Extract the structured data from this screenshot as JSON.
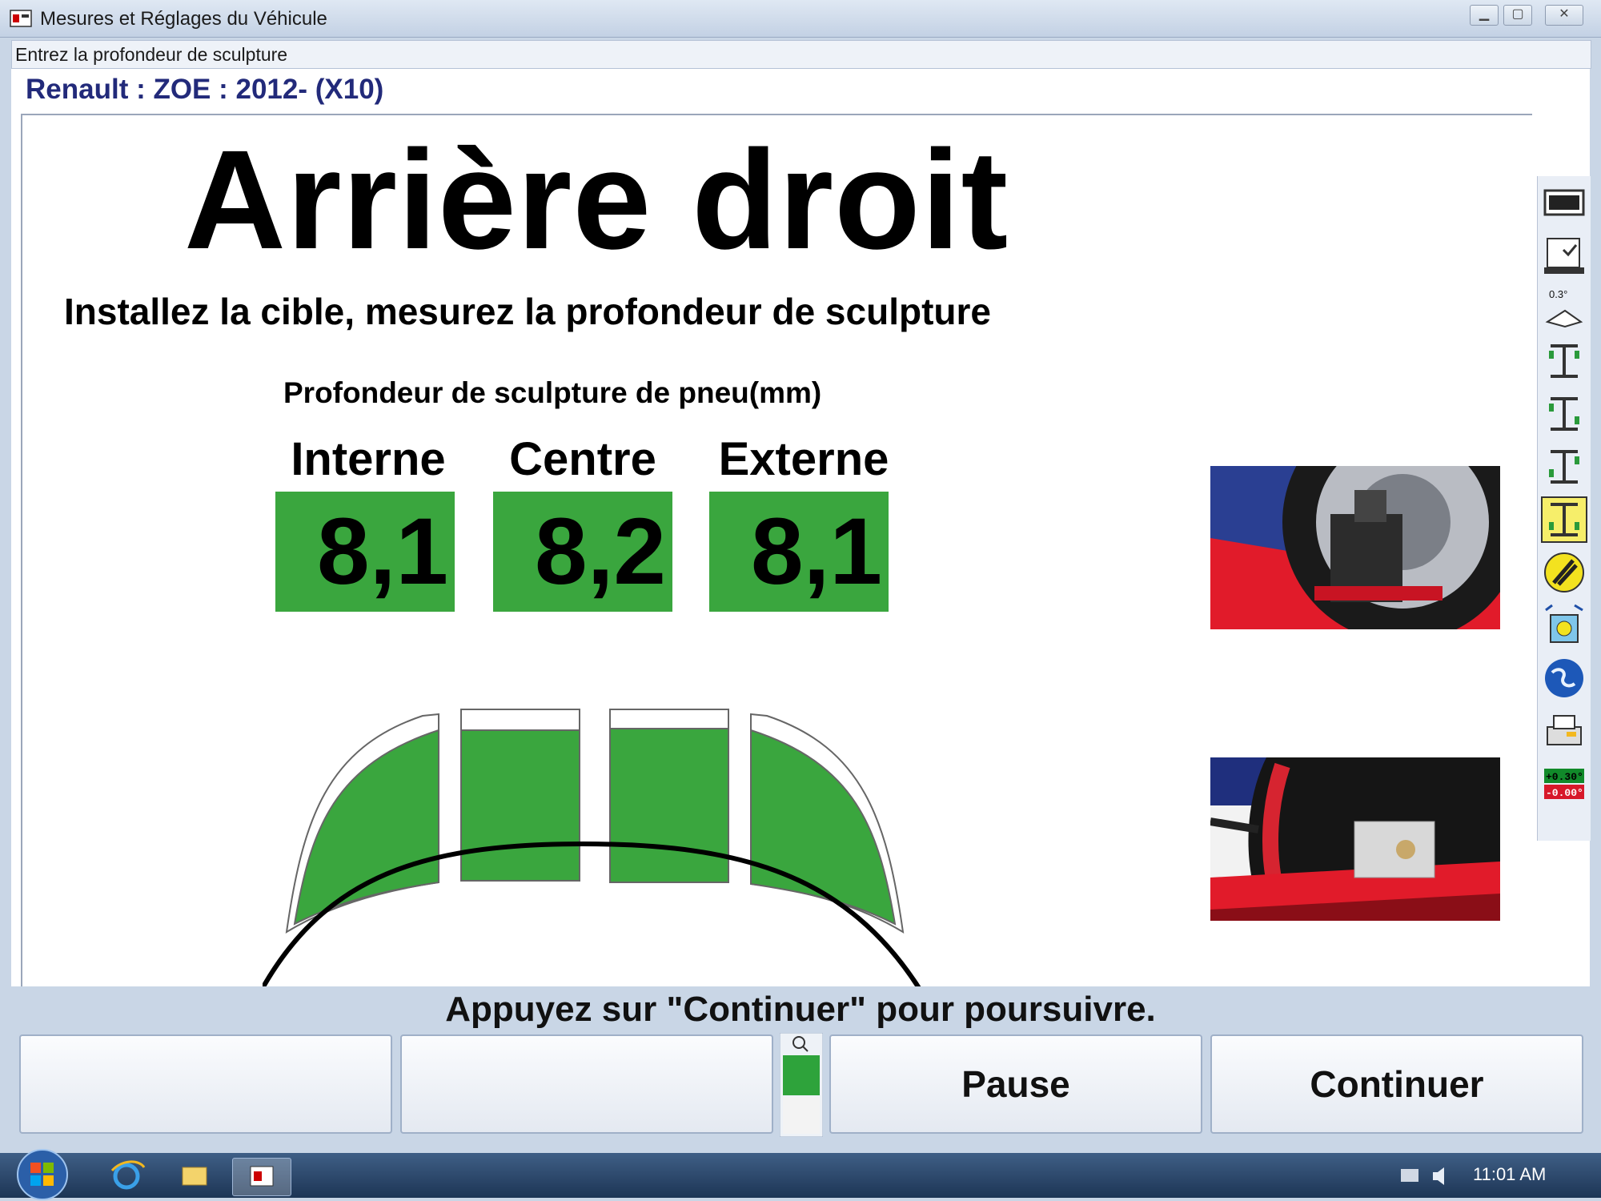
{
  "window": {
    "title": "Mesures et Réglages du Véhicule"
  },
  "prompt": "Entrez la profondeur de sculpture",
  "vehicle": "Renault : ZOE : 2012-   (X10)",
  "heading": "Arrière droit",
  "instruction": "Installez la cible, mesurez la profondeur de sculpture",
  "depth_title": "Profondeur de sculpture de pneu(mm)",
  "columns": [
    {
      "label": "Interne",
      "value": "8,1"
    },
    {
      "label": "Centre",
      "value": "8,2"
    },
    {
      "label": "Externe",
      "value": "8,1"
    }
  ],
  "status": "Appuyez sur \"Continuer\" pour poursuivre.",
  "buttons": {
    "f1": "",
    "f2": "",
    "pause": "Pause",
    "continue": "Continuer"
  },
  "toolbar_icons": [
    "counter-icon",
    "checklist-icon",
    "angle-spec-icon",
    "axle-icon",
    "axle-icon",
    "axle-icon",
    "axle-icon",
    "tools-icon",
    "camera-icon",
    "globe-icon",
    "printer-icon",
    "readings-icon"
  ],
  "toolbar_text": {
    "angle": "0.3°",
    "read_pos": "+0.30°",
    "read_neg": "-0.00°"
  },
  "taskbar": {
    "clock": "11:01 AM"
  },
  "colors": {
    "value_green": "#3aa63e",
    "vehicle_blue": "#222a7a",
    "chrome": "#c9d6e6"
  }
}
